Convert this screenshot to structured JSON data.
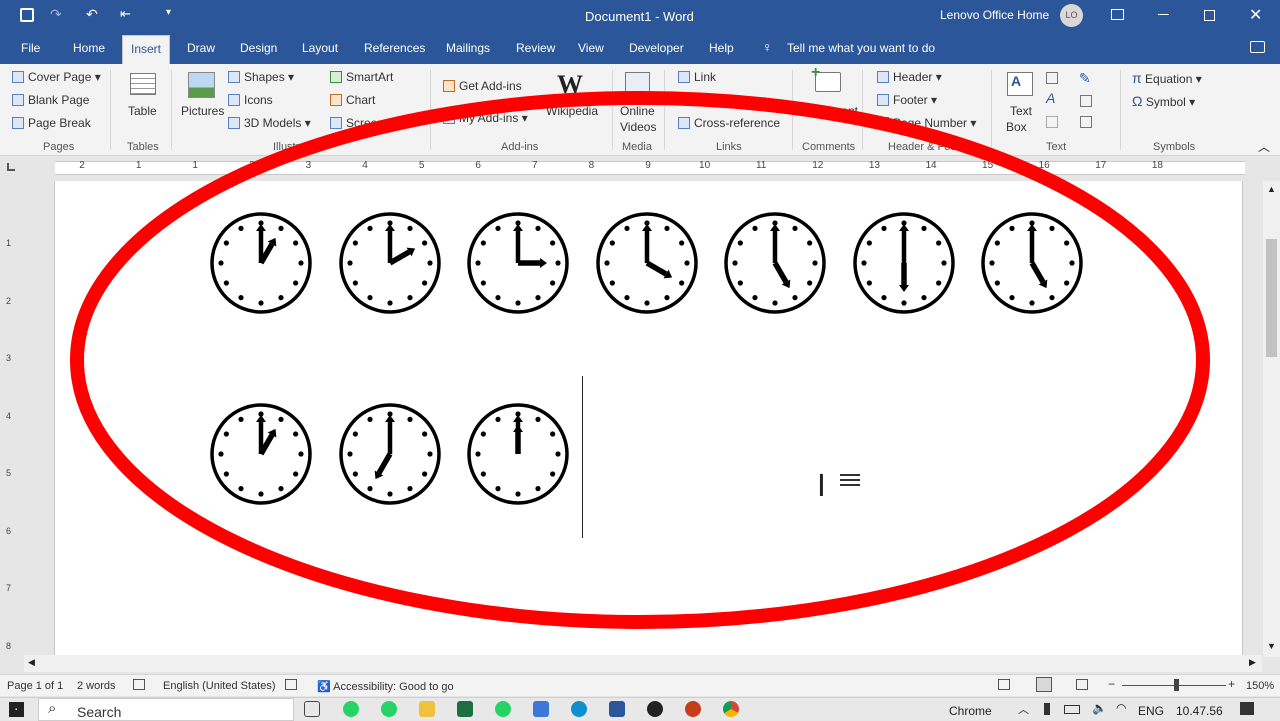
{
  "window": {
    "title": "Document1  -  Word",
    "account_name": "Lenovo Office Home",
    "account_initials": "LO"
  },
  "tabs": [
    "File",
    "Home",
    "Insert",
    "Draw",
    "Design",
    "Layout",
    "References",
    "Mailings",
    "Review",
    "View",
    "Developer",
    "Help"
  ],
  "tell_me": "Tell me what you want to do",
  "ribbon": {
    "pages": {
      "cover_page": "Cover Page",
      "blank_page": "Blank Page",
      "page_break": "Page Break",
      "group": "Pages"
    },
    "tables": {
      "table": "Table",
      "group": "Tables"
    },
    "illustrations": {
      "pictures": "Pictures",
      "shapes": "Shapes",
      "icons": "Icons",
      "models": "3D Models",
      "smartart": "SmartArt",
      "chart": "Chart",
      "screenshot": "Screensh",
      "group": "Illustr"
    },
    "addins": {
      "get_addins": "Get Add-ins",
      "my_addins": "My Add-ins",
      "wikipedia": "Wikipedia",
      "group": "Add-ins"
    },
    "media": {
      "online": "Online",
      "videos": "Videos",
      "group": "Media"
    },
    "links": {
      "link": "Link",
      "crossref": "Cross-reference",
      "group": "Links"
    },
    "comments": {
      "comment": "Comment",
      "group": "Comments"
    },
    "header_footer": {
      "header": "Header",
      "footer": "Footer",
      "page_number": "Page Number",
      "group": "Header & Foo"
    },
    "text": {
      "text": "Text",
      "box": "Box",
      "group": "Text"
    },
    "symbols": {
      "equation": "Equation",
      "symbol": "Symbol",
      "group": "Symbols"
    }
  },
  "ruler_numbers": [
    "2",
    "1",
    "1",
    "2",
    "3",
    "4",
    "5",
    "6",
    "7",
    "8",
    "9",
    "10",
    "11",
    "12",
    "13",
    "14",
    "15",
    "16",
    "17",
    "18"
  ],
  "vruler_numbers": [
    "1",
    "2",
    "3",
    "4",
    "5",
    "6",
    "7",
    "8"
  ],
  "clocks": [
    {
      "hour": 1,
      "minute": 0
    },
    {
      "hour": 2,
      "minute": 0
    },
    {
      "hour": 3,
      "minute": 0
    },
    {
      "hour": 4,
      "minute": 0
    },
    {
      "hour": 5,
      "minute": 0
    },
    {
      "hour": 6,
      "minute": 0
    },
    {
      "hour": 5,
      "minute": 0
    },
    {
      "hour": 1,
      "minute": 0
    },
    {
      "hour": 7,
      "minute": 0
    },
    {
      "hour": 12,
      "minute": 0
    }
  ],
  "status": {
    "page": "Page 1 of 1",
    "words": "2 words",
    "language": "English (United States)",
    "accessibility": "Accessibility: Good to go",
    "zoom": "150%"
  },
  "taskbar": {
    "search": "Search",
    "app": "Chrome",
    "lang": "ENG",
    "time": "10.47.56"
  },
  "colors": {
    "word_blue": "#2b579a",
    "annotation_red": "#ff0000"
  }
}
